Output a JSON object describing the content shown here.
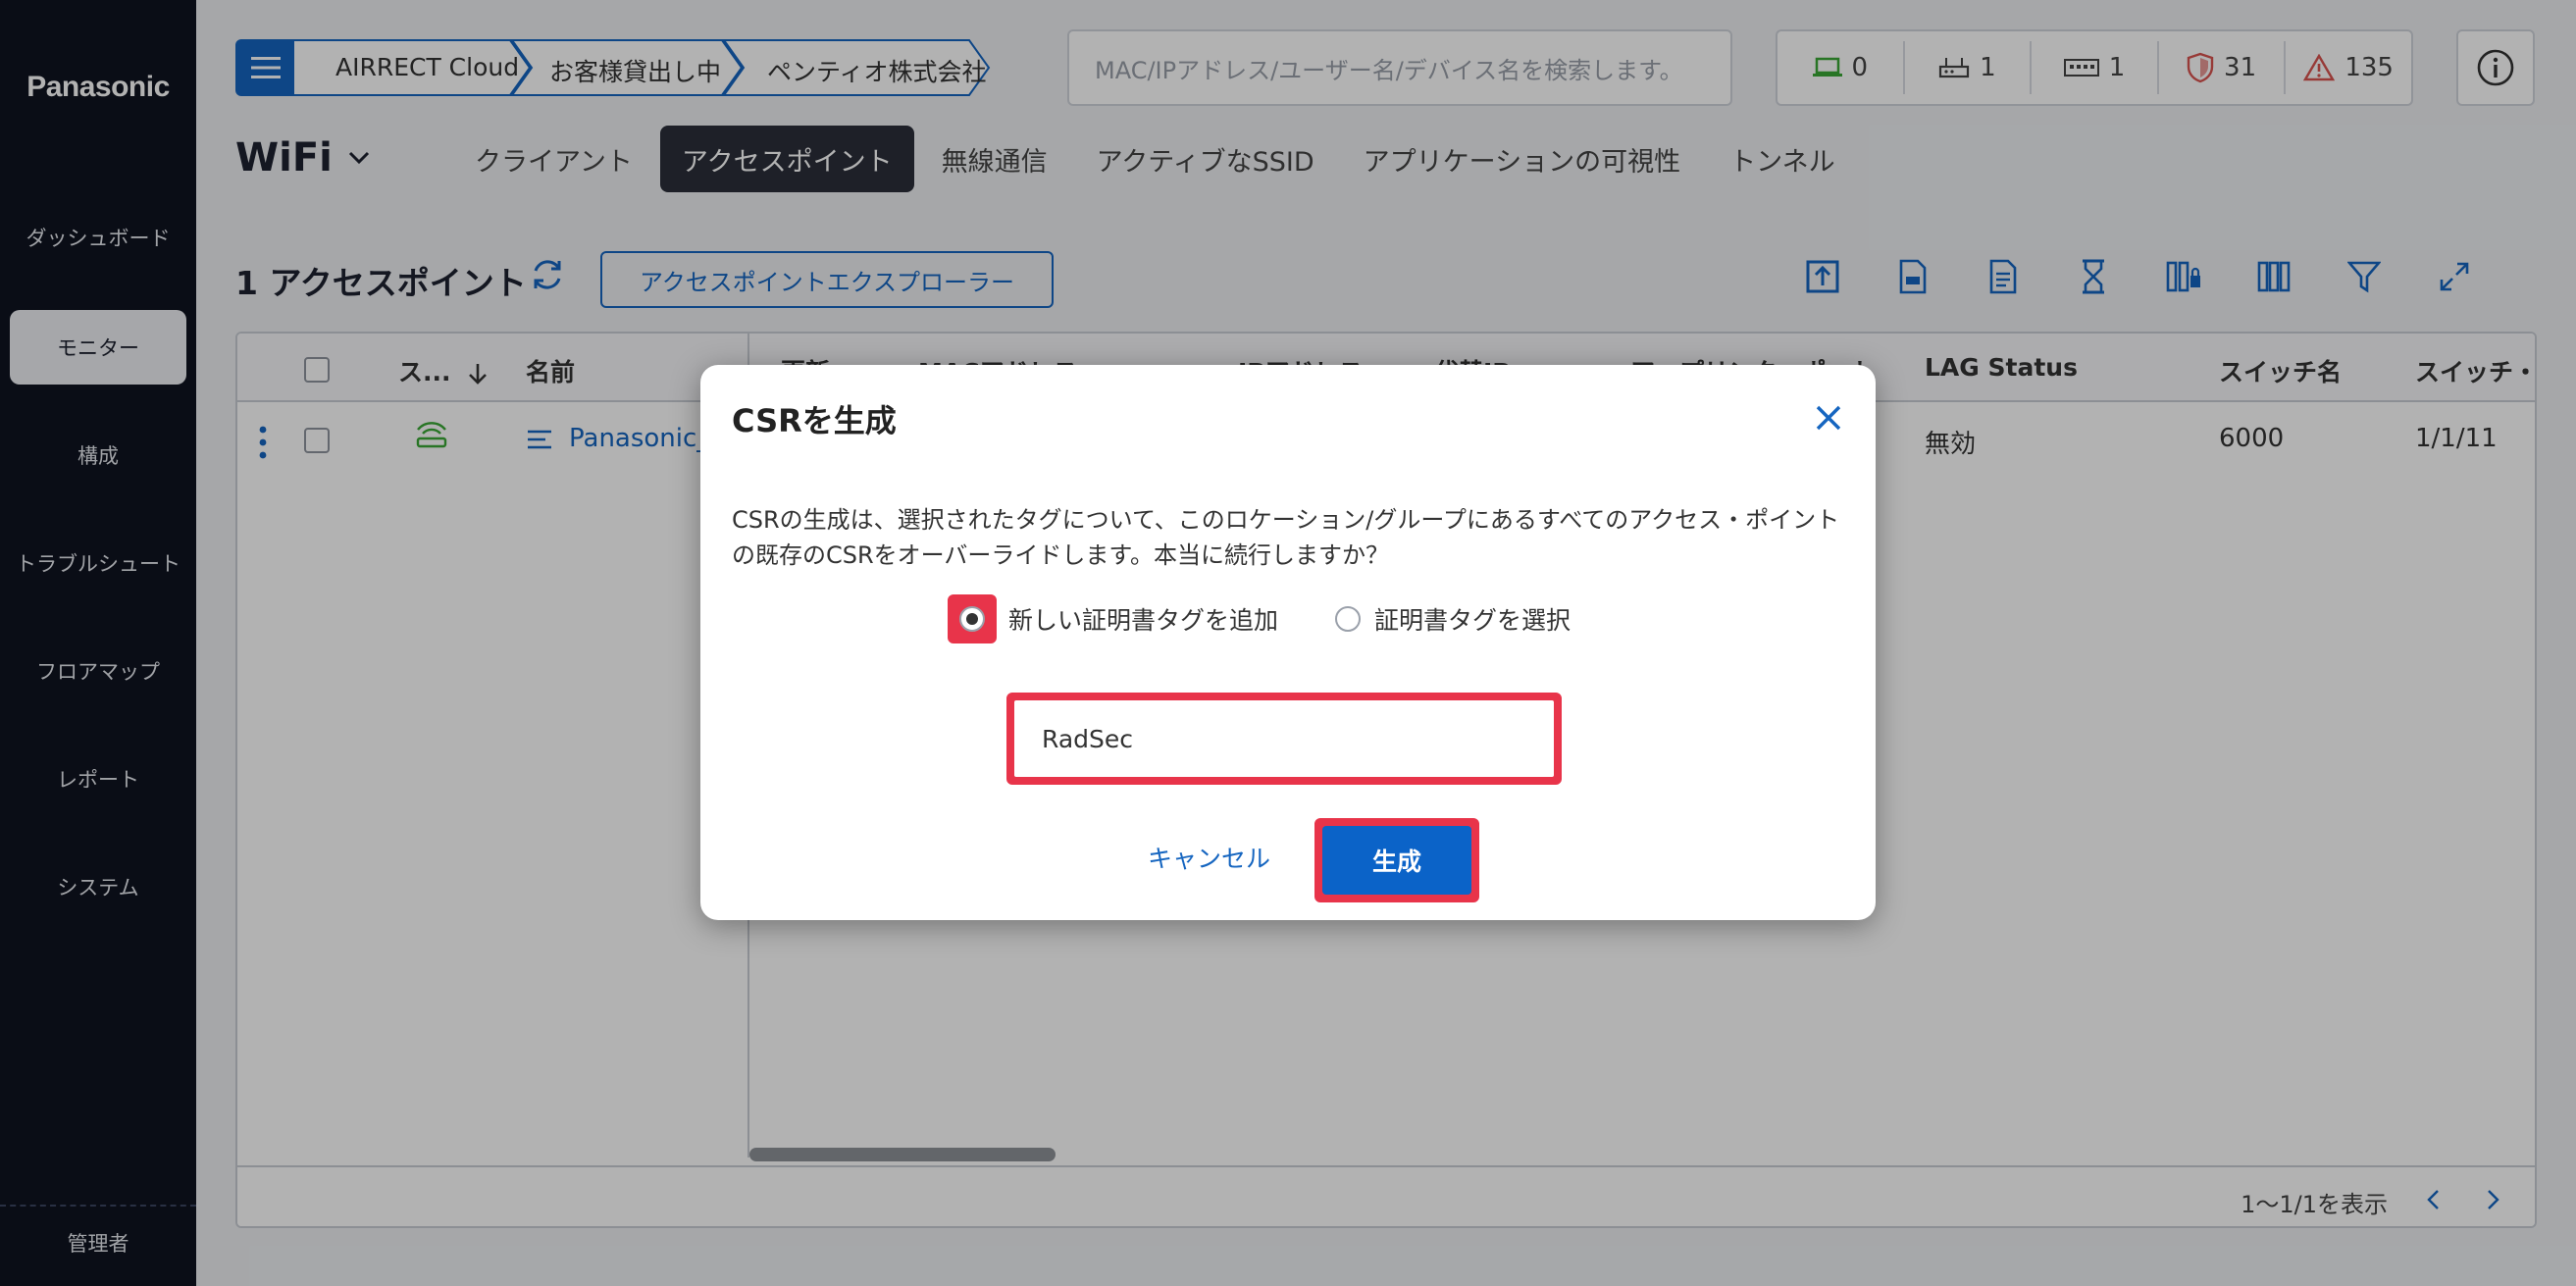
{
  "sidebar": {
    "logo": "Panasonic",
    "items": [
      {
        "label": "ダッシュボード"
      },
      {
        "label": "モニター"
      },
      {
        "label": "構成"
      },
      {
        "label": "トラブルシュート"
      },
      {
        "label": "フロアマップ"
      },
      {
        "label": "レポート"
      },
      {
        "label": "システム"
      }
    ],
    "active_index": 1,
    "footer_label": "管理者"
  },
  "header": {
    "breadcrumb": [
      "AIRRECT Cloud",
      "お客様貸出し中",
      "ペンティオ株式会社"
    ],
    "search_placeholder": "MAC/IPアドレス/ユーザー名/デバイス名を検索します。",
    "stats": [
      {
        "icon": "laptop-icon",
        "value": "0",
        "color": "#3aa835"
      },
      {
        "icon": "router-icon",
        "value": "1",
        "color": "#444444"
      },
      {
        "icon": "switch-icon",
        "value": "1",
        "color": "#444444"
      },
      {
        "icon": "shield-icon",
        "value": "31",
        "color": "#d9534f"
      },
      {
        "icon": "warning-icon",
        "value": "135",
        "color": "#d9534f"
      }
    ]
  },
  "page": {
    "title": "WiFi",
    "tabs": [
      "クライアント",
      "アクセスポイント",
      "無線通信",
      "アクティブなSSID",
      "アプリケーションの可視性",
      "トンネル"
    ],
    "active_tab": 1,
    "count_label": "1 アクセスポイント",
    "explorer_button": "アクセスポイントエクスプローラー"
  },
  "table": {
    "columns": [
      "ス...",
      "名前",
      "更新...",
      "MACアドレス",
      "IPアドレス",
      "代替IP",
      "アップリンク・ポート",
      "LAG Status",
      "スイッチ名",
      "スイッチ・..."
    ],
    "row": {
      "name": "Panasonic_",
      "lag_status": "無効",
      "switch_name": "6000",
      "switch_port": "1/1/11"
    },
    "pager": "1〜1/1を表示"
  },
  "modal": {
    "title": "CSRを生成",
    "description": "CSRの生成は、選択されたタグについて、このロケーション/グループにあるすべてのアクセス・ポイントの既存のCSRをオーバーライドします。本当に続行しますか？",
    "radio_new": "新しい証明書タグを追加",
    "radio_select": "証明書タグを選択",
    "input_value": "RadSec",
    "cancel": "キャンセル",
    "generate": "生成"
  },
  "colors": {
    "accent": "#1565c0",
    "highlight": "#e8344a",
    "sidebar_bg": "#0f1320"
  }
}
